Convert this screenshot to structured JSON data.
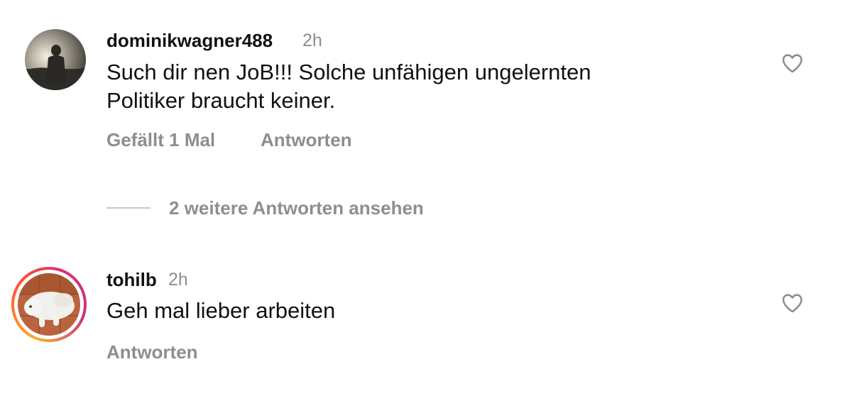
{
  "comments": [
    {
      "username": "dominikwagner488",
      "time": "2h",
      "text_line1": "Such dir nen JoB!!! Solche unfähigen ungelernten",
      "text_line2": "Politiker braucht keiner.",
      "likes_label": "Gefällt 1 Mal",
      "reply_label": "Antworten",
      "like_icon": "heart-outline-icon",
      "has_story_ring": false
    },
    {
      "username": "tohilb",
      "time": "2h",
      "text_line1": "Geh mal lieber arbeiten",
      "reply_label": "Antworten",
      "like_icon": "heart-outline-icon",
      "has_story_ring": true
    }
  ],
  "view_replies_label": "2 weitere Antworten ansehen",
  "colors": {
    "text_primary": "#111111",
    "text_secondary": "#8e8e8e",
    "divider": "#c7c7c7",
    "story_ring_start": "#f9b12e",
    "story_ring_end": "#c13584"
  }
}
